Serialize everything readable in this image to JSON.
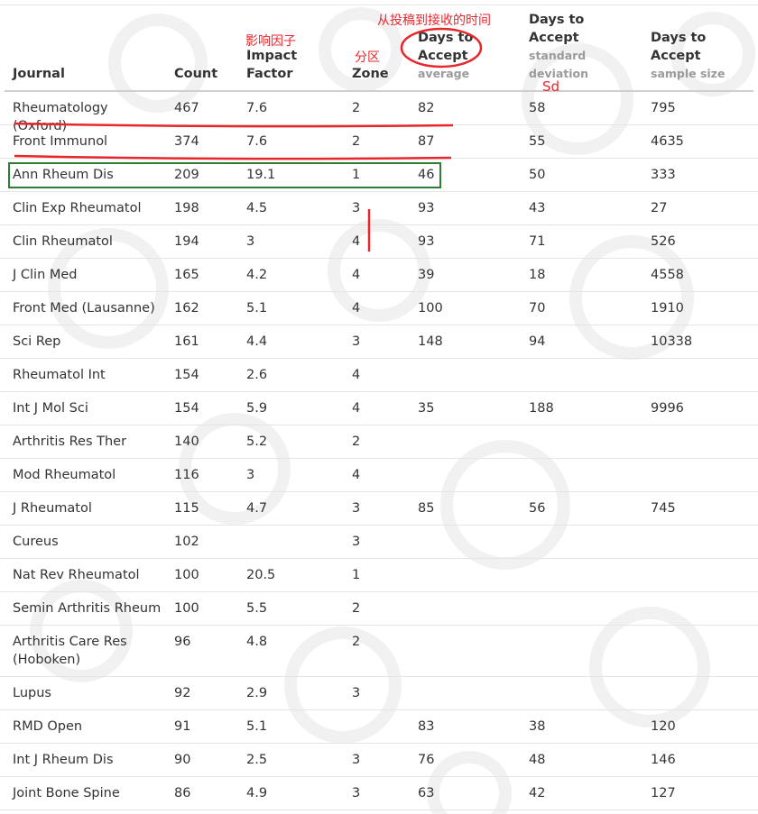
{
  "table": {
    "headers": {
      "journal": "Journal",
      "count": "Count",
      "impact_line1": "Impact",
      "impact_line2": "Factor",
      "zone": "Zone",
      "avg_line1": "Days to",
      "avg_line2": "Accept",
      "avg_sub": "average",
      "sd_line1": "Days to",
      "sd_line2": "Accept",
      "sd_sub1": "standard",
      "sd_sub2": "deviation",
      "n_line1": "Days to",
      "n_line2": "Accept",
      "n_sub": "sample size"
    },
    "rows": [
      {
        "journal": "Rheumatology (Oxford)",
        "count": "467",
        "impact": "7.6",
        "zone": "2",
        "avg": "82",
        "sd": "58",
        "n": "795"
      },
      {
        "journal": "Front Immunol",
        "count": "374",
        "impact": "7.6",
        "zone": "2",
        "avg": "87",
        "sd": "55",
        "n": "4635"
      },
      {
        "journal": "Ann Rheum Dis",
        "count": "209",
        "impact": "19.1",
        "zone": "1",
        "avg": "46",
        "sd": "50",
        "n": "333"
      },
      {
        "journal": "Clin Exp Rheumatol",
        "count": "198",
        "impact": "4.5",
        "zone": "3",
        "avg": "93",
        "sd": "43",
        "n": "27"
      },
      {
        "journal": "Clin Rheumatol",
        "count": "194",
        "impact": "3",
        "zone": "4",
        "avg": "93",
        "sd": "71",
        "n": "526"
      },
      {
        "journal": "J Clin Med",
        "count": "165",
        "impact": "4.2",
        "zone": "4",
        "avg": "39",
        "sd": "18",
        "n": "4558"
      },
      {
        "journal": "Front Med (Lausanne)",
        "count": "162",
        "impact": "5.1",
        "zone": "4",
        "avg": "100",
        "sd": "70",
        "n": "1910"
      },
      {
        "journal": "Sci Rep",
        "count": "161",
        "impact": "4.4",
        "zone": "3",
        "avg": "148",
        "sd": "94",
        "n": "10338"
      },
      {
        "journal": "Rheumatol Int",
        "count": "154",
        "impact": "2.6",
        "zone": "4",
        "avg": "",
        "sd": "",
        "n": ""
      },
      {
        "journal": "Int J Mol Sci",
        "count": "154",
        "impact": "5.9",
        "zone": "4",
        "avg": "35",
        "sd": "188",
        "n": "9996"
      },
      {
        "journal": "Arthritis Res Ther",
        "count": "140",
        "impact": "5.2",
        "zone": "2",
        "avg": "",
        "sd": "",
        "n": ""
      },
      {
        "journal": "Mod Rheumatol",
        "count": "116",
        "impact": "3",
        "zone": "4",
        "avg": "",
        "sd": "",
        "n": ""
      },
      {
        "journal": "J Rheumatol",
        "count": "115",
        "impact": "4.7",
        "zone": "3",
        "avg": "85",
        "sd": "56",
        "n": "745"
      },
      {
        "journal": "Cureus",
        "count": "102",
        "impact": "",
        "zone": "3",
        "avg": "",
        "sd": "",
        "n": ""
      },
      {
        "journal": "Nat Rev Rheumatol",
        "count": "100",
        "impact": "20.5",
        "zone": "1",
        "avg": "",
        "sd": "",
        "n": ""
      },
      {
        "journal": "Semin Arthritis Rheum",
        "count": "100",
        "impact": "5.5",
        "zone": "2",
        "avg": "",
        "sd": "",
        "n": ""
      },
      {
        "journal": "Arthritis Care Res (Hoboken)",
        "count": "96",
        "impact": "4.8",
        "zone": "2",
        "avg": "",
        "sd": "",
        "n": ""
      },
      {
        "journal": "Lupus",
        "count": "92",
        "impact": "2.9",
        "zone": "3",
        "avg": "",
        "sd": "",
        "n": ""
      },
      {
        "journal": "RMD Open",
        "count": "91",
        "impact": "5.1",
        "zone": "",
        "avg": "83",
        "sd": "38",
        "n": "120"
      },
      {
        "journal": "Int J Rheum Dis",
        "count": "90",
        "impact": "2.5",
        "zone": "3",
        "avg": "76",
        "sd": "48",
        "n": "146"
      },
      {
        "journal": "Joint Bone Spine",
        "count": "86",
        "impact": "4.9",
        "zone": "3",
        "avg": "63",
        "sd": "42",
        "n": "127"
      }
    ]
  },
  "annotations": {
    "impact_factor_cn": "影响因子",
    "zone_cn": "分区",
    "days_to_accept_cn": "从投稿到接收的时间",
    "sd_label": "Sd",
    "annotation_color": "#e8262b",
    "highlight_box_color": "#2e7d32"
  }
}
